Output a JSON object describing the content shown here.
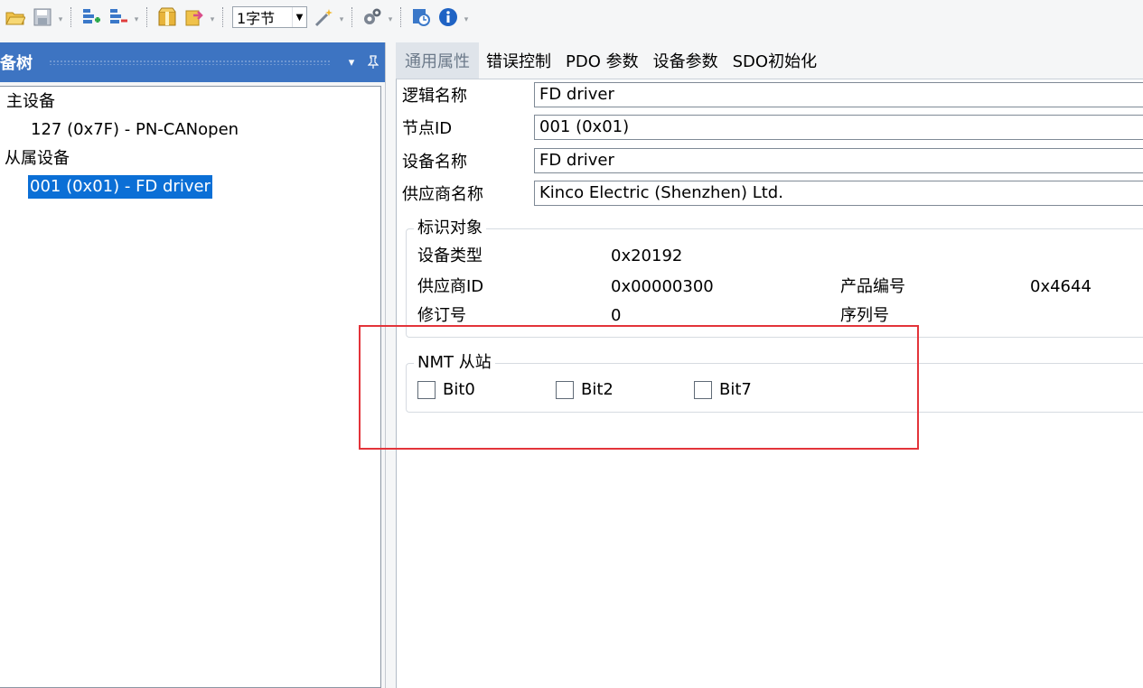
{
  "toolbar": {
    "byte_combo_value": "1字节",
    "icons": [
      "open-folder-icon",
      "save-icon",
      "add-slave-icon",
      "remove-slave-icon",
      "package-icon",
      "export-icon",
      "wand-icon",
      "gear-icon",
      "clock-refresh-icon",
      "info-icon"
    ]
  },
  "device_tree": {
    "title": "备树",
    "items": [
      {
        "label": "主设备"
      },
      {
        "label": "127 (0x7F)  -  PN-CANopen"
      },
      {
        "label": "从属设备"
      },
      {
        "label": "001 (0x01)  -  FD driver",
        "selected": true
      }
    ]
  },
  "tabs": [
    {
      "label": "通用属性",
      "active": true
    },
    {
      "label": "错误控制"
    },
    {
      "label": "PDO 参数"
    },
    {
      "label": "设备参数"
    },
    {
      "label": "SDO初始化"
    }
  ],
  "general": {
    "fields": [
      {
        "label": "逻辑名称",
        "value": "FD driver"
      },
      {
        "label": "节点ID",
        "value": "001 (0x01)"
      },
      {
        "label": "设备名称",
        "value": "FD driver"
      },
      {
        "label": "供应商名称",
        "value": "Kinco Electric (Shenzhen) Ltd."
      }
    ],
    "identity": {
      "title": "标识对象",
      "device_type_label": "设备类型",
      "device_type_value": "0x20192",
      "vendor_id_label": "供应商ID",
      "vendor_id_value": "0x00000300",
      "product_code_label": "产品编号",
      "product_code_value": "0x4644",
      "revision_label": "修订号",
      "revision_value": "0",
      "serial_label": "序列号",
      "serial_value": ""
    },
    "nmt": {
      "title": "NMT 从站",
      "checkboxes": [
        {
          "label": "Bit0",
          "checked": false
        },
        {
          "label": "Bit2",
          "checked": false
        },
        {
          "label": "Bit7",
          "checked": false
        }
      ]
    }
  },
  "colors": {
    "accent": "#3d74c2",
    "selection": "#0b6fd6",
    "annotation_box": "#e3343a"
  }
}
